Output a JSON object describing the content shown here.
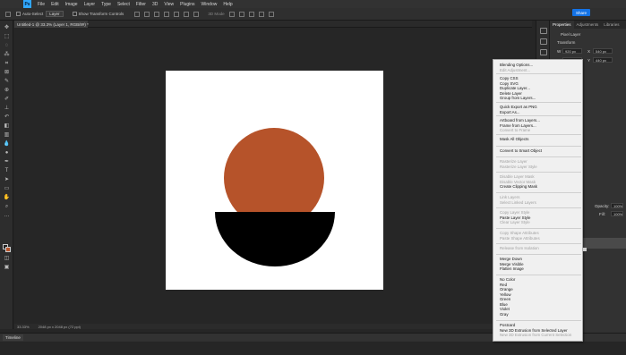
{
  "app": {
    "logo": "Ps",
    "menu": [
      "File",
      "Edit",
      "Image",
      "Layer",
      "Type",
      "Select",
      "Filter",
      "3D",
      "View",
      "Plugins",
      "Window",
      "Help"
    ],
    "share_label": "Share"
  },
  "options_bar": {
    "auto_select_label": "Auto-Select",
    "auto_select_target": "Layer",
    "transform_controls_label": "Show Transform Controls",
    "mode_3d_label": "3D Mode"
  },
  "document": {
    "tab_title": "Untitled-1 @ 33.3% (Layer 1, RGB/8#) *",
    "zoom_status": "33.33%",
    "size_status": "2048 px x 2048 px (72 ppi)",
    "shapes": {
      "circle_color": "#b6532a",
      "half_circle_color": "#000000",
      "background_color": "#ffffff"
    }
  },
  "panels": {
    "tabs": [
      "Properties",
      "Adjustments",
      "Libraries"
    ],
    "properties": {
      "layer_type": "Pixel Layer",
      "section_transform": "Transform",
      "w_label": "W",
      "w_value": "920 px",
      "h_label": "H",
      "h_value": "920 px",
      "x_label": "X",
      "x_value": "540 px",
      "y_label": "Y",
      "y_value": "440 px"
    },
    "layers": {
      "opacity_label": "Opacity:",
      "opacity_value": "100%",
      "fill_label": "Fill:",
      "fill_value": "100%"
    }
  },
  "context_menu": {
    "items": [
      {
        "label": "Blending Options...",
        "enabled": true
      },
      {
        "label": "Edit Adjustment...",
        "enabled": false
      },
      {
        "label": "Copy CSS",
        "enabled": true
      },
      {
        "label": "Copy SVG",
        "enabled": true
      },
      {
        "label": "Duplicate Layer...",
        "enabled": true
      },
      {
        "label": "Delete Layer",
        "enabled": true
      },
      {
        "label": "Group from Layers...",
        "enabled": true
      },
      {
        "label": "Quick Export as PNG",
        "enabled": true
      },
      {
        "label": "Export As...",
        "enabled": true
      },
      {
        "label": "Artboard from Layers...",
        "enabled": true
      },
      {
        "label": "Frame from Layers...",
        "enabled": true
      },
      {
        "label": "Convert to Frame",
        "enabled": false
      },
      {
        "label": "Mask All Objects",
        "enabled": true
      },
      {
        "label": "Convert to Smart Object",
        "enabled": true
      },
      {
        "label": "Rasterize Layer",
        "enabled": false
      },
      {
        "label": "Rasterize Layer Style",
        "enabled": false
      },
      {
        "label": "Disable Layer Mask",
        "enabled": false
      },
      {
        "label": "Disable Vector Mask",
        "enabled": false
      },
      {
        "label": "Create Clipping Mask",
        "enabled": true
      },
      {
        "label": "Link Layers",
        "enabled": false
      },
      {
        "label": "Select Linked Layers",
        "enabled": false
      },
      {
        "label": "Copy Layer Style",
        "enabled": false
      },
      {
        "label": "Paste Layer Style",
        "enabled": true
      },
      {
        "label": "Clear Layer Style",
        "enabled": false
      },
      {
        "label": "Copy Shape Attributes",
        "enabled": false
      },
      {
        "label": "Paste Shape Attributes",
        "enabled": false
      },
      {
        "label": "Release from Isolation",
        "enabled": false
      },
      {
        "label": "Merge Down",
        "enabled": true
      },
      {
        "label": "Merge Visible",
        "enabled": true
      },
      {
        "label": "Flatten Image",
        "enabled": true
      },
      {
        "label": "No Color",
        "enabled": true
      },
      {
        "label": "Red",
        "enabled": true
      },
      {
        "label": "Orange",
        "enabled": true
      },
      {
        "label": "Yellow",
        "enabled": true
      },
      {
        "label": "Green",
        "enabled": true
      },
      {
        "label": "Blue",
        "enabled": true
      },
      {
        "label": "Violet",
        "enabled": true
      },
      {
        "label": "Gray",
        "enabled": true
      },
      {
        "label": "Postcard",
        "enabled": true
      },
      {
        "label": "New 3D Extrusion from Selected Layer",
        "enabled": true
      },
      {
        "label": "New 3D Extrusion from Current Selection",
        "enabled": false
      }
    ]
  },
  "timeline": {
    "tab_label": "Timeline"
  },
  "colors": {
    "accent": "#31a8ff",
    "share_button": "#1473e6",
    "background_teal": "#1fb7a6",
    "background_pink": "#e8538f"
  }
}
